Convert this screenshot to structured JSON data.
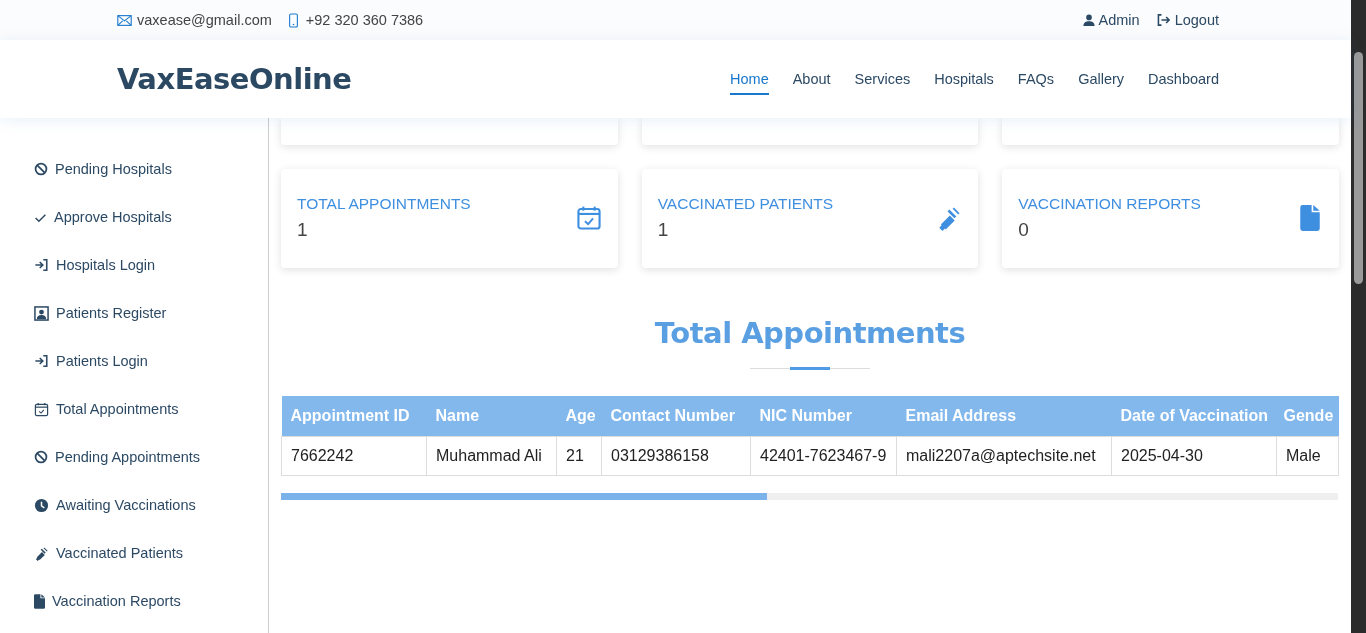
{
  "topbar": {
    "email": "vaxease@gmail.com",
    "phone": "+92 320 360 7386",
    "user": "Admin",
    "logout": "Logout"
  },
  "header": {
    "logo": "VaxEaseOnline",
    "nav": [
      {
        "label": "Home",
        "selected": true
      },
      {
        "label": "About",
        "selected": false
      },
      {
        "label": "Services",
        "selected": false
      },
      {
        "label": "Hospitals",
        "selected": false
      },
      {
        "label": "FAQs",
        "selected": false
      },
      {
        "label": "Gallery",
        "selected": false
      },
      {
        "label": "Dashboard",
        "selected": false
      }
    ]
  },
  "sidebar": {
    "items": [
      {
        "label": "Pending Hospitals",
        "kind": "ban"
      },
      {
        "label": "Approve Hospitals",
        "kind": "check"
      },
      {
        "label": "Hospitals Login",
        "kind": "login"
      },
      {
        "label": "Patients Register",
        "kind": "person"
      },
      {
        "label": "Patients Login",
        "kind": "login"
      },
      {
        "label": "Total Appointments",
        "kind": "calendar"
      },
      {
        "label": "Pending Appointments",
        "kind": "ban"
      },
      {
        "label": "Awaiting Vaccinations",
        "kind": "clock"
      },
      {
        "label": "Vaccinated Patients",
        "kind": "syringe"
      },
      {
        "label": "Vaccination Reports",
        "kind": "file"
      }
    ]
  },
  "stat_cards": [
    {
      "title": "TOTAL APPOINTMENTS",
      "value": "1",
      "kind": "calendar"
    },
    {
      "title": "VACCINATED PATIENTS",
      "value": "1",
      "kind": "syringe"
    },
    {
      "title": "VACCINATION REPORTS",
      "value": "0",
      "kind": "file"
    }
  ],
  "section_title": "Total Appointments",
  "table": {
    "columns": [
      "Appointment ID",
      "Name",
      "Age",
      "Contact Number",
      "NIC Number",
      "Email Address",
      "Date of Vaccination",
      "Gende"
    ],
    "rows": [
      [
        "7662242",
        "Muhammad Ali",
        "21",
        "03129386158",
        "42401-7623467-9",
        "mali2207a@aptechsite.net",
        "2025-04-30",
        "Male"
      ]
    ]
  }
}
